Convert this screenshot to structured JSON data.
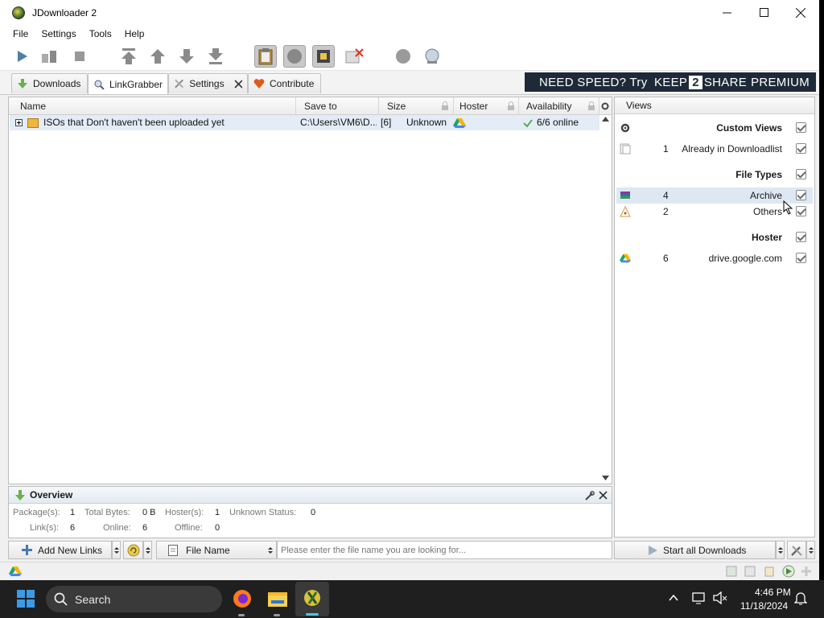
{
  "window": {
    "title": "JDownloader 2"
  },
  "menu": [
    "File",
    "Settings",
    "Tools",
    "Help"
  ],
  "tabs": [
    {
      "label": "Downloads"
    },
    {
      "label": "LinkGrabber"
    },
    {
      "label": "Settings"
    },
    {
      "label": "Contribute"
    }
  ],
  "banner": {
    "part1": "NEED SPEED? Try ",
    "keep": "KEEP",
    "two": "2",
    "share": "SHARE",
    "premium": "PREMIUM"
  },
  "table": {
    "columns": [
      "Name",
      "Save to",
      "Size",
      "Hoster",
      "Availability"
    ],
    "rows": [
      {
        "name": "ISOs that Don't haven't been uploaded yet",
        "save_to": "C:\\Users\\VM6\\D...",
        "count": "[6]",
        "size": "Unknown",
        "availability": "6/6 online"
      }
    ]
  },
  "views": {
    "title": "Views",
    "sections": [
      {
        "title": "Custom Views",
        "items": [
          {
            "count": "1",
            "label": "Already in Downloadlist"
          }
        ]
      },
      {
        "title": "File Types",
        "items": [
          {
            "count": "4",
            "label": "Archive"
          },
          {
            "count": "2",
            "label": "Others"
          }
        ]
      },
      {
        "title": "Hoster",
        "items": [
          {
            "count": "6",
            "label": "drive.google.com"
          }
        ]
      }
    ]
  },
  "overview": {
    "title": "Overview",
    "packages_label": "Package(s):",
    "packages": "1",
    "total_bytes_label": "Total Bytes:",
    "total_bytes": "0 B",
    "hosters_label": "Hoster(s):",
    "hosters": "1",
    "unknown_label": "Unknown Status:",
    "unknown": "0",
    "links_label": "Link(s):",
    "links": "6",
    "online_label": "Online:",
    "online": "6",
    "offline_label": "Offline:",
    "offline": "0"
  },
  "bottom": {
    "add_links": "Add New Links",
    "filter_field": "File Name",
    "search_placeholder": "Please enter the file name you are looking for...",
    "start_all": "Start all Downloads"
  },
  "taskbar": {
    "search": "Search",
    "time": "4:46 PM",
    "date": "11/18/2024"
  },
  "colors": {
    "accent_banner": "#1e2a38",
    "selection": "#dde8f3",
    "taskbar": "#1f1f1f"
  }
}
